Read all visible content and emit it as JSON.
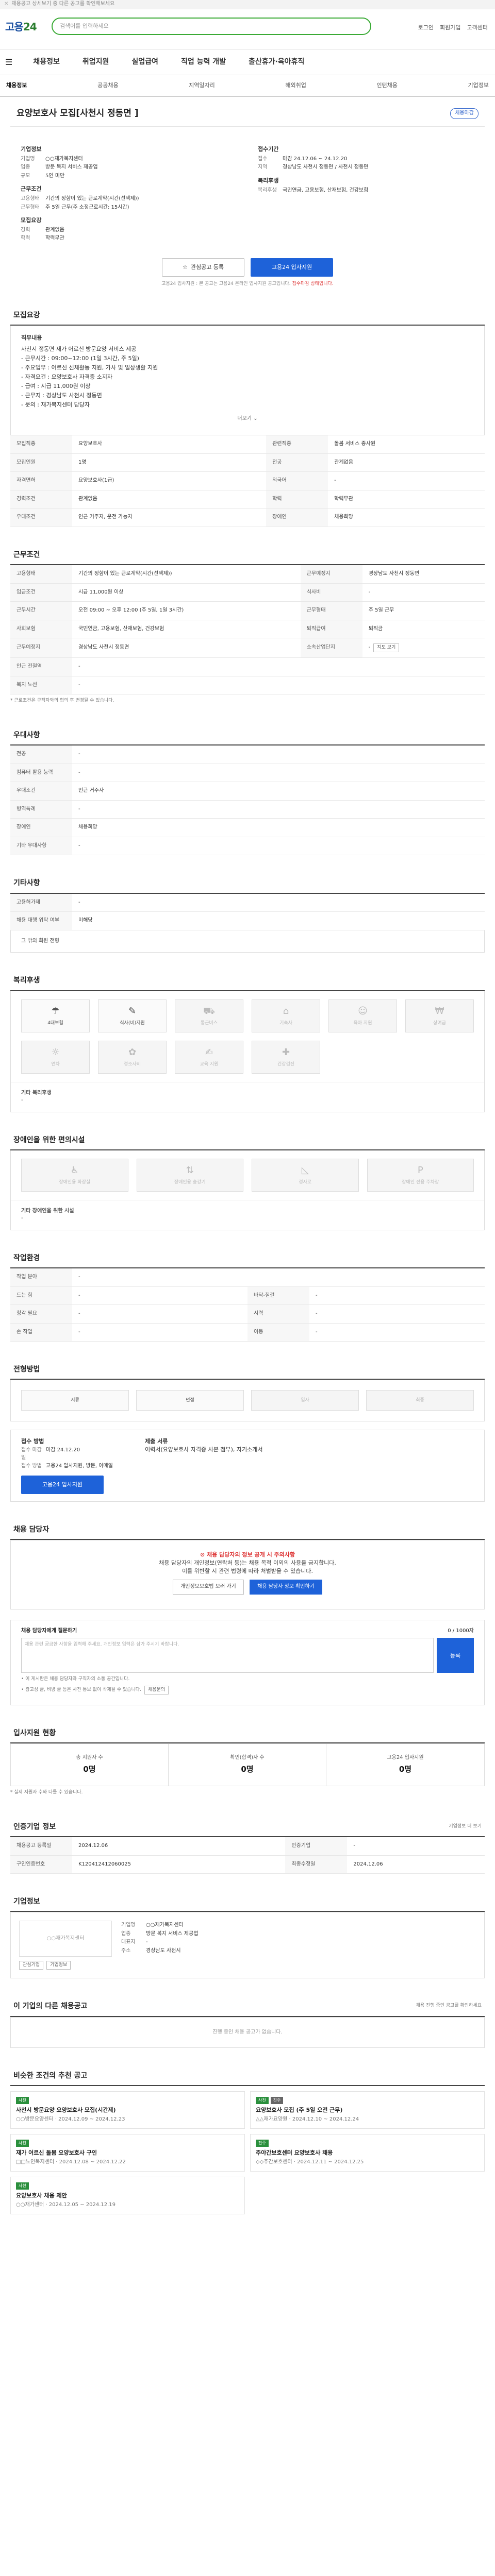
{
  "strip": {
    "text": "채용공고 상세보기 중 다른 공고를 확인해보세요",
    "close": "✕"
  },
  "header": {
    "logo_main": "고용",
    "logo_num": "24",
    "search_placeholder": "검색어를 입력하세요",
    "links": [
      "로그인",
      "회원가입",
      "고객센터"
    ]
  },
  "gnb": {
    "items": [
      "채용정보",
      "취업지원",
      "실업급여",
      "직업 능력 개발",
      "출산휴가·육아휴직"
    ]
  },
  "snb": {
    "items": [
      "채용정보",
      "공공채용",
      "지역일자리",
      "해외취업",
      "인턴채용",
      "기업정보"
    ]
  },
  "title": {
    "text": "요양보호사 모집[사천시 정동면 ]",
    "badge": "채용마감"
  },
  "summary": {
    "company_h": "기업정보",
    "company": [
      {
        "k": "기업명",
        "v": "○○재가복지센터"
      },
      {
        "k": "업종",
        "v": "방문 복지 서비스 제공업"
      },
      {
        "k": "규모",
        "v": "5인 미만"
      }
    ],
    "cond_h": "근무조건",
    "cond": [
      {
        "k": "고용형태",
        "v": "기간의 정함이 있는 근로계약(시간(선택제))"
      },
      {
        "k": "근무형태",
        "v": "주 5일 근무(주 소정근로시간: 15시간)"
      }
    ],
    "recruit_h": "모집요강",
    "recruit": [
      {
        "k": "경력",
        "v": "관계없음"
      },
      {
        "k": "학력",
        "v": "학력무관"
      }
    ],
    "period_h": "접수기간",
    "period": [
      {
        "k": "접수",
        "v": "마감 24.12.06 ~ 24.12.20"
      },
      {
        "k": "지역",
        "v": "경상남도 사천시 정동면 / 사천시 정동면"
      }
    ],
    "welfare_h": "복리후생",
    "welfare": [
      {
        "k": "복리후생",
        "v": "국민연금, 고용보험, 산재보험, 건강보험"
      }
    ]
  },
  "actions": {
    "scrap": "관심공고 등록",
    "apply": "고용24 입사지원",
    "note_prefix": "고용24 입사지원 : 본 공고는 고용24 온라인 입사지원 공고입니다.",
    "note_red": "접수마감 상태입니다."
  },
  "job_desc": {
    "title": "모집요강",
    "heading": "직무내용",
    "lines": [
      "사천시 정동면 재가 어르신 방문요양 서비스 제공",
      "- 근무시간 : 09:00~12:00 (1일 3시간, 주 5일)",
      "- 주요업무 : 어르신 신체활동 지원, 가사 및 일상생활 지원",
      "- 자격요건 : 요양보호사 자격증 소지자",
      "- 급여 : 시급 11,000원 이상",
      "- 근무지 : 경상남도 사천시 정동면",
      "- 문의 : 재가복지센터 담당자"
    ],
    "more": "더보기"
  },
  "job_table": [
    {
      "k": "모집직종",
      "v": "요양보호사",
      "k2": "관련직종",
      "v2": "돌봄 서비스 종사원"
    },
    {
      "k": "모집인원",
      "v": "1명",
      "k2": "전공",
      "v2": "관계없음"
    },
    {
      "k": "자격면허",
      "v": "요양보호사(1급)",
      "k2": "외국어",
      "v2": "-"
    },
    {
      "k": "경력조건",
      "v": "관계없음",
      "k2": "학력",
      "v2": "학력무관"
    },
    {
      "k": "우대조건",
      "v": "인근 거주자, 운전 가능자",
      "k2": "장애인",
      "v2": "채용희망"
    }
  ],
  "work": {
    "title": "근무조건",
    "table": [
      {
        "k": "고용형태",
        "v": "기간의 정함이 있는 근로계약(시간(선택제))",
        "k2": "근무예정지",
        "v2": "경상남도 사천시 정동면"
      },
      {
        "k": "임금조건",
        "v": "시급 11,000원 이상",
        "k2": "식사비",
        "v2": "-"
      },
      {
        "k": "근무시간",
        "v": "오전 09:00 ~ 오후 12:00 (주 5일, 1일 3시간)",
        "k2": "근무형태",
        "v2": "주 5일 근무"
      },
      {
        "k": "사회보험",
        "v": "국민연금, 고용보험, 산재보험, 건강보험",
        "k2": "퇴직급여",
        "v2": "퇴직금"
      },
      {
        "k": "근무예정지",
        "v": "경상남도 사천시 정동면",
        "k2": "소속산업단지",
        "v2": "-"
      },
      {
        "k": "인근 전철역",
        "v": "-",
        "k2": "",
        "v2": ""
      },
      {
        "k": "복지 노선",
        "v": "-",
        "k2": "",
        "v2": ""
      }
    ],
    "map_btn": "지도 보기",
    "footnote": "* 근로조건은 구직자와의 협의 후 변경될 수 있습니다."
  },
  "benefit": {
    "title": "우대사항",
    "rows": [
      {
        "k": "전공",
        "v": "-"
      },
      {
        "k": "컴퓨터 활용 능력",
        "v": "-"
      },
      {
        "k": "우대조건",
        "v": "인근 거주자"
      },
      {
        "k": "병역특례",
        "v": "-"
      },
      {
        "k": "장애인",
        "v": "채용희망"
      },
      {
        "k": "기타 우대사항",
        "v": "-"
      }
    ]
  },
  "extra": {
    "title": "기타사항",
    "rows": [
      {
        "k": "고용허가제",
        "v": "-"
      },
      {
        "k": "채용 대행 위탁 여부",
        "v": "미해당"
      }
    ],
    "sub": "그 밖의 회원 전형"
  },
  "welfare": {
    "title": "복리후생",
    "icons": [
      {
        "name": "insurance-icon",
        "label": "4대보험",
        "sym": "☂",
        "on": true
      },
      {
        "name": "meal-icon",
        "label": "식사(비)지원",
        "sym": "✎",
        "on": true
      },
      {
        "name": "commute-icon",
        "label": "통근버스",
        "sym": "⛟",
        "on": false
      },
      {
        "name": "dorm-icon",
        "label": "기숙사",
        "sym": "⌂",
        "on": false
      },
      {
        "name": "child-icon",
        "label": "육아 지원",
        "sym": "☺",
        "on": false
      },
      {
        "name": "bonus-icon",
        "label": "상여금",
        "sym": "₩",
        "on": false
      },
      {
        "name": "vacation-icon",
        "label": "연차",
        "sym": "☼",
        "on": false
      },
      {
        "name": "gift-icon",
        "label": "경조사비",
        "sym": "✿",
        "on": false
      },
      {
        "name": "training-icon",
        "label": "교육 지원",
        "sym": "✍",
        "on": false
      },
      {
        "name": "health-icon",
        "label": "건강검진",
        "sym": "✚",
        "on": false
      }
    ],
    "other_h": "기타 복리후생",
    "other_v": "-"
  },
  "disability": {
    "title": "장애인을 위한 편의시설",
    "icons": [
      {
        "name": "accessible-icon",
        "label": "장애인용 화장실"
      },
      {
        "name": "elevator-icon",
        "label": "장애인용 승강기"
      },
      {
        "name": "ramp-icon",
        "label": "경사로"
      },
      {
        "name": "parking-icon",
        "label": "장애인 전용 주차장"
      }
    ],
    "other_h": "기타 장애인을 위한 시설",
    "other_v": "-"
  },
  "env": {
    "title": "작업환경",
    "rows": [
      {
        "k": "작업 분야",
        "v": "-",
        "k2": "",
        "v2": ""
      },
      {
        "k": "드는 힘",
        "v": "-",
        "k2": "바닥-칠걸",
        "v2": "-"
      },
      {
        "k": "청각 필요",
        "v": "-",
        "k2": "시력",
        "v2": "-"
      },
      {
        "k": "손 작업",
        "v": "-",
        "k2": "이동",
        "v2": "-"
      }
    ]
  },
  "process": {
    "title": "전형방법",
    "steps": [
      "서류",
      "면접",
      "입사",
      "최종"
    ]
  },
  "apply_info": {
    "title": "접수 방법",
    "rows": [
      {
        "k": "접수 마감일",
        "v": "마감 24.12.20"
      },
      {
        "k": "접수 방법",
        "v": "고용24 입사지원, 방문, 이메일"
      }
    ],
    "btn": "고용24 입사지원",
    "docs_h": "제출 서류",
    "docs": "이력서(요양보호사 자격증 사본 첨부), 자기소개서"
  },
  "manager": {
    "title": "채용 담당자",
    "headline": "채용 담당자의 정보 공개 시 주의사항",
    "line1": "채용 담당자의 개인정보(연락처 등)는 채용 목적 이외의 사용을 금지합니다.",
    "line2": "이를 위반할 시 관련 법령에 따라 처벌받을 수 있습니다.",
    "btn1": "개인정보보호법 보러 가기",
    "btn2": "채용 담당자 정보 확인하기"
  },
  "qa": {
    "title": "채용 담당자에게 질문하기",
    "counter": "0 / 1000자",
    "placeholder": "채용 관련 궁금한 사항을 입력해 주세요. 개인정보 입력은 삼가 주시기 바랍니다.",
    "submit": "등록",
    "notes": [
      "• 이 게시판은 채용 담당자와 구직자의 소통 공간입니다.",
      "• 광고성 글, 비방 글 등은 사전 통보 없이 삭제될 수 있습니다."
    ],
    "btn": "채용문의"
  },
  "stats": {
    "title": "입사지원 현황",
    "items": [
      {
        "k": "총 지원자 수",
        "v": "0명"
      },
      {
        "k": "확인(합격)자 수",
        "v": "0명"
      },
      {
        "k": "고용24 입사지원",
        "v": "0명"
      }
    ],
    "note": "* 실제 지원자 수와 다를 수 있습니다."
  },
  "meta": {
    "title": "인증기업 정보",
    "right": "기업정보 더 보기",
    "rows": [
      {
        "k": "채용공고 등록일",
        "v": "2024.12.06",
        "k2": "인증기업",
        "v2": "-"
      },
      {
        "k": "구인인증번호",
        "v": "K120412412060025",
        "k2": "최종수정일",
        "v2": "2024.12.06"
      }
    ]
  },
  "company": {
    "title": "기업정보",
    "logo": "○○재가복지센터",
    "rows": [
      {
        "k": "기업명",
        "v": "○○재가복지센터"
      },
      {
        "k": "업종",
        "v": "방문 복지 서비스 제공업"
      },
      {
        "k": "대표자",
        "v": "-"
      },
      {
        "k": "주소",
        "v": "경상남도 사천시"
      }
    ],
    "btn1": "관심기업",
    "btn2": "기업정보"
  },
  "others": {
    "title": "이 기업의 다른 채용공고",
    "right": "채용 진행 중인 공고를 확인하세요",
    "empty": "진행 중인 채용 공고가 없습니다."
  },
  "recommend": {
    "title": "비슷한 조건의 추천 공고",
    "cards": [
      {
        "tag": "사천",
        "tag2": "",
        "title": "사천시 방문요양 요양보호사 모집(시간제)",
        "meta": "○○방문요양센터 · 2024.12.09 ~ 2024.12.23"
      },
      {
        "tag": "사천",
        "tag2": "진주",
        "title": "요양보호사 모집 (주 5일 오전 근무)",
        "meta": "△△재가요양원 · 2024.12.10 ~ 2024.12.24"
      },
      {
        "tag": "사천",
        "tag2": "",
        "title": "재가 어르신 돌봄 요양보호사 구인",
        "meta": "□□노인복지센터 · 2024.12.08 ~ 2024.12.22"
      },
      {
        "tag": "진주",
        "tag2": "",
        "title": "주야간보호센터 요양보호사 채용",
        "meta": "◇◇주간보호센터 · 2024.12.11 ~ 2024.12.25"
      },
      {
        "tag": "사천",
        "tag2": "",
        "title": "요양보호사 채용 제안",
        "meta": "○○재가센터 · 2024.12.05 ~ 2024.12.19"
      }
    ]
  }
}
